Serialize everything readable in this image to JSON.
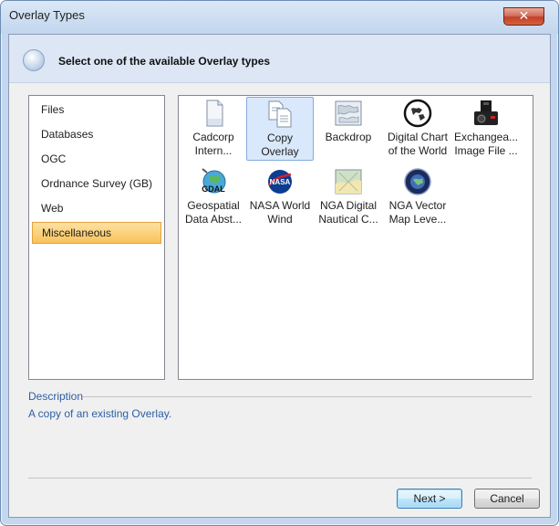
{
  "window": {
    "title": "Overlay Types",
    "close_glyph": "✕"
  },
  "header": {
    "icon": "globe-icon",
    "text": "Select one of the available Overlay types"
  },
  "categories": [
    {
      "label": "Files",
      "selected": false
    },
    {
      "label": "Databases",
      "selected": false
    },
    {
      "label": "OGC",
      "selected": false
    },
    {
      "label": "Ordnance Survey (GB)",
      "selected": false
    },
    {
      "label": "Web",
      "selected": false
    },
    {
      "label": "Miscellaneous",
      "selected": true
    }
  ],
  "overlay_types": [
    {
      "label": "Cadcorp\nIntern...",
      "icon": "document-icon",
      "selected": false
    },
    {
      "label": "Copy Overlay",
      "icon": "copy-documents-icon",
      "selected": true
    },
    {
      "label": "Backdrop",
      "icon": "map-sheet-icon",
      "selected": false
    },
    {
      "label": "Digital Chart\nof the World",
      "icon": "world-globe-icon",
      "selected": false
    },
    {
      "label": "Exchangea...\nImage File ...",
      "icon": "camera-icon",
      "selected": false
    },
    {
      "label": "Geospatial\nData Abst...",
      "icon": "gdal-globe-icon",
      "icon_text": "GDAL",
      "selected": false
    },
    {
      "label": "NASA World\nWind",
      "icon": "nasa-logo-icon",
      "icon_text": "NASA",
      "selected": false
    },
    {
      "label": "NGA Digital\nNautical C...",
      "icon": "nautical-chart-icon",
      "selected": false
    },
    {
      "label": "NGA Vector\nMap Leve...",
      "icon": "nga-seal-icon",
      "selected": false
    }
  ],
  "description": {
    "label": "Description",
    "text": "A copy of an existing Overlay."
  },
  "buttons": {
    "next": "Next >",
    "cancel": "Cancel"
  },
  "colors": {
    "selection_orange": "#f9c25a",
    "selection_blue": "#d9e8fb",
    "description_text": "#2c5fa7",
    "nasa_blue": "#0b3d91",
    "nasa_red": "#d21f2c"
  }
}
